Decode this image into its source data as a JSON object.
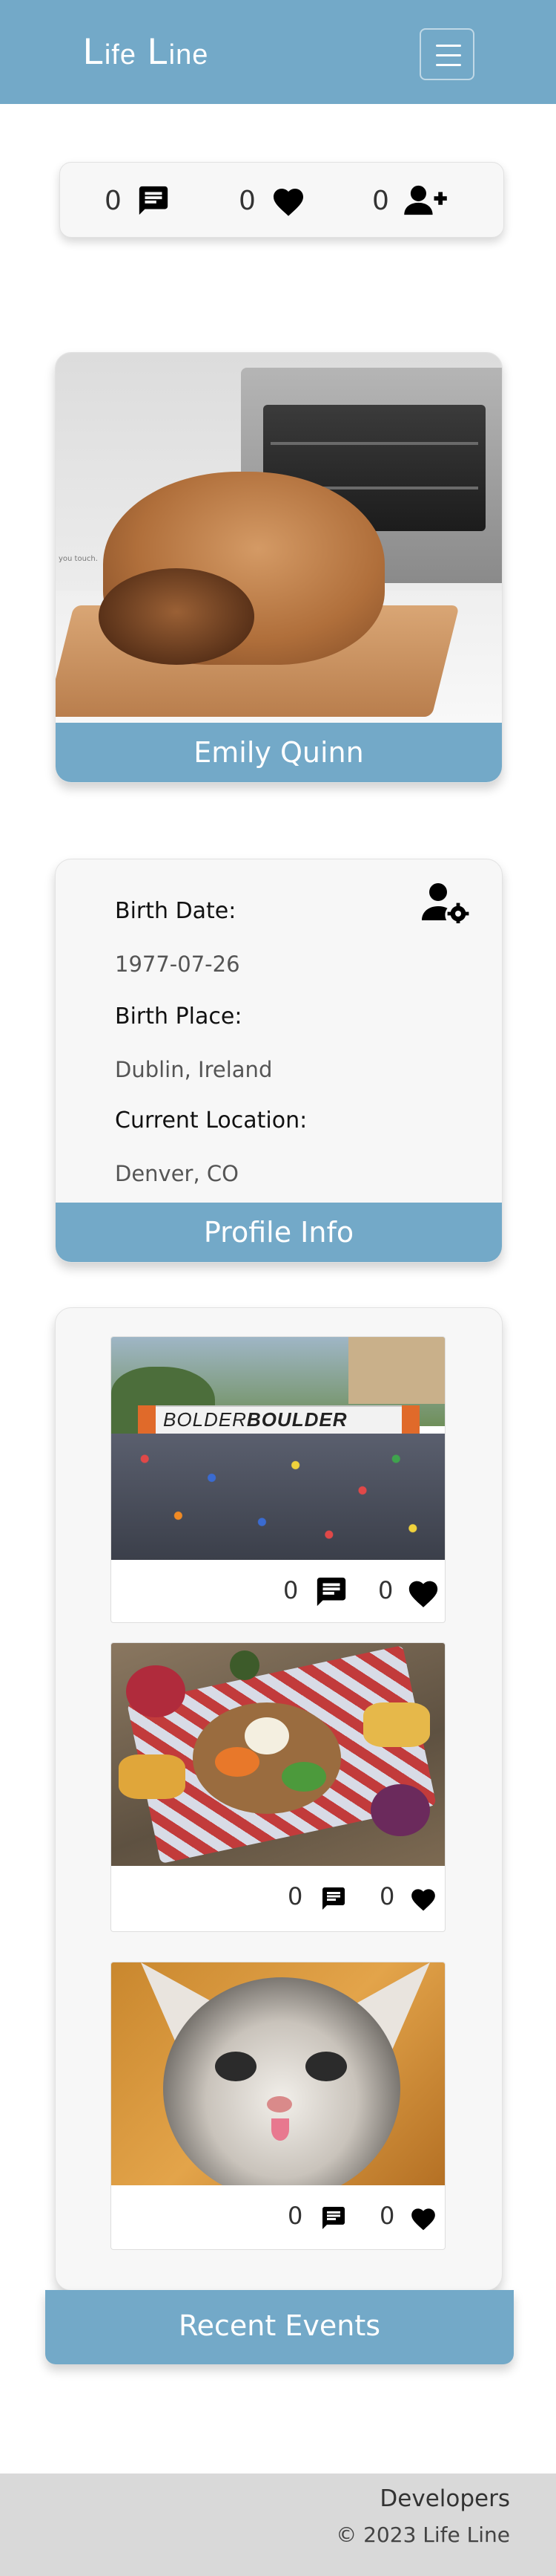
{
  "navbar": {
    "brand_first": "L",
    "brand_first_rest": "ife",
    "brand_second": "L",
    "brand_second_rest": "ine",
    "menu_icon": "hamburger-icon",
    "color": "#73a9c8"
  },
  "stats": {
    "messages": {
      "count": "0",
      "icon": "message-icon"
    },
    "likes": {
      "count": "0",
      "icon": "heart-icon"
    },
    "friends": {
      "count": "0",
      "icon": "add-user-icon"
    }
  },
  "profile": {
    "name": "Emily Quinn",
    "photo_caption": "you touch."
  },
  "info": {
    "settings_icon": "user-gear-icon",
    "birth_date_label": "Birth Date:",
    "birth_date": "1977-07-26",
    "birth_place_label": "Birth Place:",
    "birth_place": "Dublin, Ireland",
    "location_label": "Current Location:",
    "location": "Denver, CO",
    "footer": "Profile Info"
  },
  "events": {
    "items": [
      {
        "image": "race-start-photo",
        "banner_a": "BOLDER",
        "banner_b": "BOULDER",
        "comments": "0",
        "likes": "0"
      },
      {
        "image": "charcuterie-board-photo",
        "comments": "0",
        "likes": "0"
      },
      {
        "image": "kitten-photo",
        "comments": "0",
        "likes": "0"
      }
    ],
    "footer": "Recent Events"
  },
  "footer": {
    "developers": "Developers",
    "copyright": "© 2023 Life Line"
  }
}
